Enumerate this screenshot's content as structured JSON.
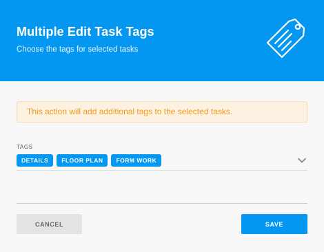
{
  "header": {
    "title": "Multiple Edit Task Tags",
    "subtitle": "Choose the tags for selected tasks",
    "icon": "tag-icon"
  },
  "alert": {
    "message": "This action will add additional tags to the selected tasks."
  },
  "tags_field": {
    "label": "TAGS",
    "selected": [
      "DETAILS",
      "FLOOR PLAN",
      "FORM WORK"
    ],
    "dropdown_icon": "chevron-down-icon"
  },
  "actions": {
    "cancel_label": "CANCEL",
    "save_label": "SAVE"
  },
  "colors": {
    "primary": "#0497f1",
    "warning_text": "#ef9a1b",
    "warning_bg": "#fdf1e1"
  }
}
